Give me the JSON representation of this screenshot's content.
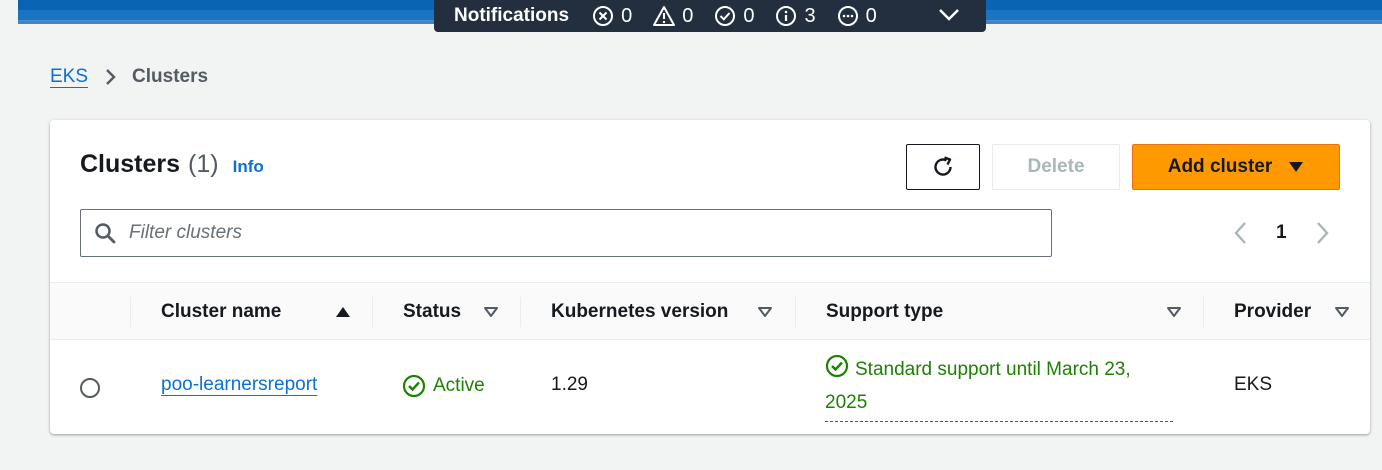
{
  "notifications": {
    "title": "Notifications",
    "counts": [
      {
        "icon": "error-icon",
        "value": "0"
      },
      {
        "icon": "warning-icon",
        "value": "0"
      },
      {
        "icon": "success-icon",
        "value": "0"
      },
      {
        "icon": "info-icon",
        "value": "3"
      },
      {
        "icon": "in-progress-icon",
        "value": "0"
      }
    ]
  },
  "breadcrumb": {
    "root": "EKS",
    "current": "Clusters"
  },
  "panel": {
    "title": "Clusters",
    "count": "(1)",
    "info": "Info",
    "delete_label": "Delete",
    "add_label": "Add cluster",
    "filter_placeholder": "Filter clusters",
    "page": "1"
  },
  "table": {
    "columns": [
      "Cluster name",
      "Status",
      "Kubernetes version",
      "Support type",
      "Provider"
    ],
    "rows": [
      {
        "name": "poo-learnersreport",
        "status": "Active",
        "version": "1.29",
        "support_line1": "Standard support until March 23,",
        "support_line2": "2025",
        "provider": "EKS"
      }
    ]
  },
  "colors": {
    "accent": "#0972d3",
    "primary_button": "#ff9900",
    "success": "#1d8102",
    "header_bar": "#232f3e"
  }
}
